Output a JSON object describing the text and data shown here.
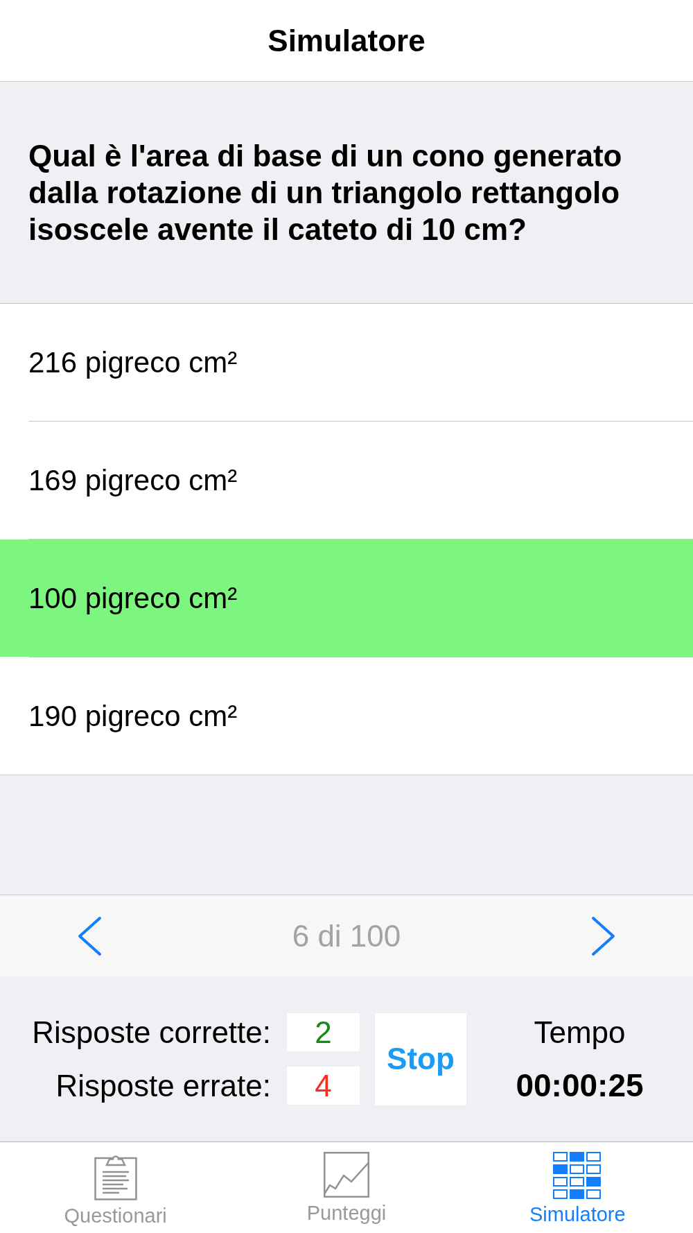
{
  "navigation_bar": {
    "title": "Simulatore"
  },
  "question": {
    "text": "Qual è l'area di base di un cono generato dalla rotazione di un triangolo rettangolo isoscele avente il cateto di 10 cm?"
  },
  "answers": [
    {
      "text": "216 pigreco cm²",
      "selected": false
    },
    {
      "text": "169 pigreco cm²",
      "selected": false
    },
    {
      "text": "100 pigreco cm²",
      "selected": true
    },
    {
      "text": "190 pigreco cm²",
      "selected": false
    }
  ],
  "pager": {
    "position": "6 di 100"
  },
  "score": {
    "counters": [
      {
        "label": "Risposte corrette:",
        "value": "2",
        "color": "#138a13"
      },
      {
        "label": "Risposte errate:",
        "value": "4",
        "color": "#fc2d1c"
      }
    ],
    "stop_button": "Stop",
    "timer": {
      "label": "Tempo",
      "value": "00:00:25"
    }
  },
  "tab_bar": [
    {
      "label": "Questionari",
      "selected": false
    },
    {
      "label": "Punteggi",
      "selected": false
    },
    {
      "label": "Simulatore",
      "selected": true
    }
  ]
}
